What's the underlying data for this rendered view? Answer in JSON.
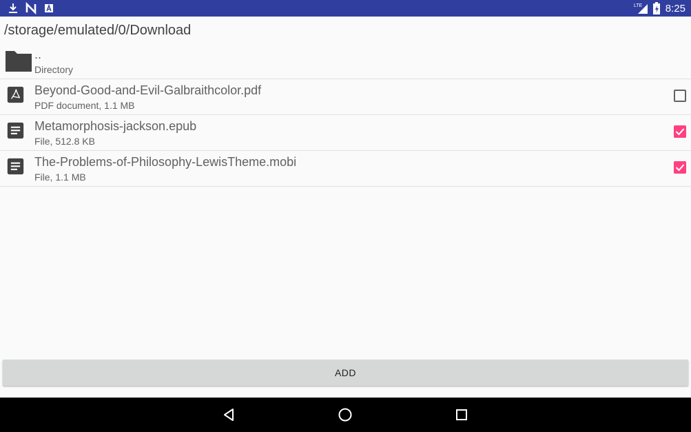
{
  "status_bar": {
    "time": "8:25",
    "network": "LTE",
    "left_icons": [
      "download-icon",
      "n-notification-icon",
      "a-notification-icon"
    ],
    "color": "#303f9f"
  },
  "path_title": "/storage/emulated/0/Download",
  "files": [
    {
      "name": "..",
      "meta": "Directory",
      "icon": "folder-icon",
      "checkable": false,
      "checked": false
    },
    {
      "name": "Beyond-Good-and-Evil-Galbraithcolor.pdf",
      "meta": "PDF document, 1.1 MB",
      "icon": "pdf-icon",
      "checkable": true,
      "checked": false
    },
    {
      "name": "Metamorphosis-jackson.epub",
      "meta": "File, 512.8 KB",
      "icon": "document-icon",
      "checkable": true,
      "checked": true
    },
    {
      "name": "The-Problems-of-Philosophy-LewisTheme.mobi",
      "meta": "File, 1.1 MB",
      "icon": "document-icon",
      "checkable": true,
      "checked": true
    }
  ],
  "add_button": {
    "label": "ADD"
  },
  "nav_bar": {
    "buttons": [
      "back-icon",
      "home-icon",
      "recents-icon"
    ]
  },
  "colors": {
    "accent": "#ff4081",
    "text": "#616161",
    "divider": "#e0e0e0"
  }
}
